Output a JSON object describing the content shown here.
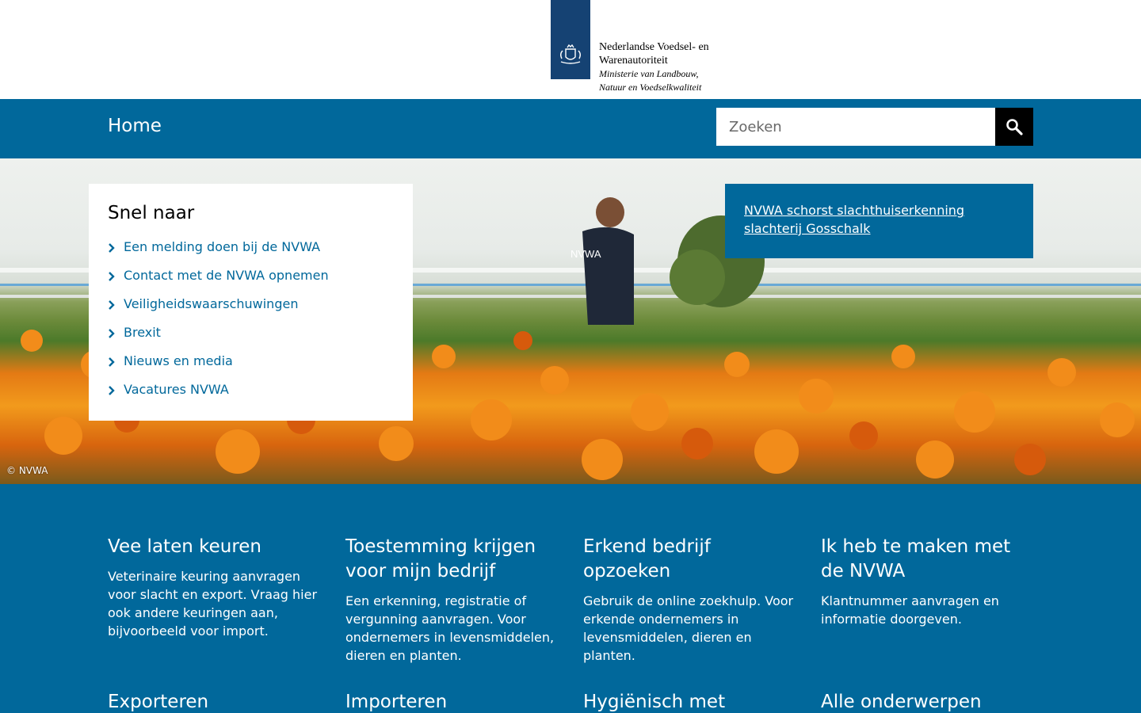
{
  "header": {
    "logo_line1": "Nederlandse Voedsel- en",
    "logo_line2": "Warenautoriteit",
    "logo_sub1": "Ministerie van Landbouw,",
    "logo_sub2": "Natuur en Voedselkwaliteit",
    "brand_color": "#154273"
  },
  "nav": {
    "home": "Home",
    "search_placeholder": "Zoeken",
    "search_icon": "search-icon",
    "bar_color": "#01689b"
  },
  "hero": {
    "credit": "© NVWA",
    "quicklinks": {
      "title": "Snel naar",
      "items": [
        "Een melding doen bij de NVWA",
        "Contact met de NVWA opnemen",
        "Veiligheidswaarschuwingen",
        "Brexit",
        "Nieuws en media",
        "Vacatures NVWA"
      ]
    },
    "news": "NVWA schorst slachthuiserkenning slachterij Gosschalk"
  },
  "topics": [
    {
      "title": "Vee laten keuren",
      "text": "Veterinaire keuring aanvragen voor slacht en export. Vraag hier ook andere keuringen aan, bijvoorbeeld voor import."
    },
    {
      "title": "Toestemming krijgen voor mijn bedrijf",
      "text": "Een erkenning, registratie of vergunning aanvragen. Voor ondernemers in levensmiddelen, dieren en planten."
    },
    {
      "title": "Erkend bedrijf opzoeken",
      "text": "Gebruik de online zoekhulp. Voor erkende ondernemers in levensmiddelen, dieren en planten."
    },
    {
      "title": "Ik heb te maken met de NVWA",
      "text": "Klantnummer aanvragen en informatie doorgeven."
    },
    {
      "title": "Exporteren",
      "text": ""
    },
    {
      "title": "Importeren",
      "text": ""
    },
    {
      "title": "Hygiënisch met voedsel",
      "text": ""
    },
    {
      "title": "Alle onderwerpen",
      "text": ""
    }
  ]
}
